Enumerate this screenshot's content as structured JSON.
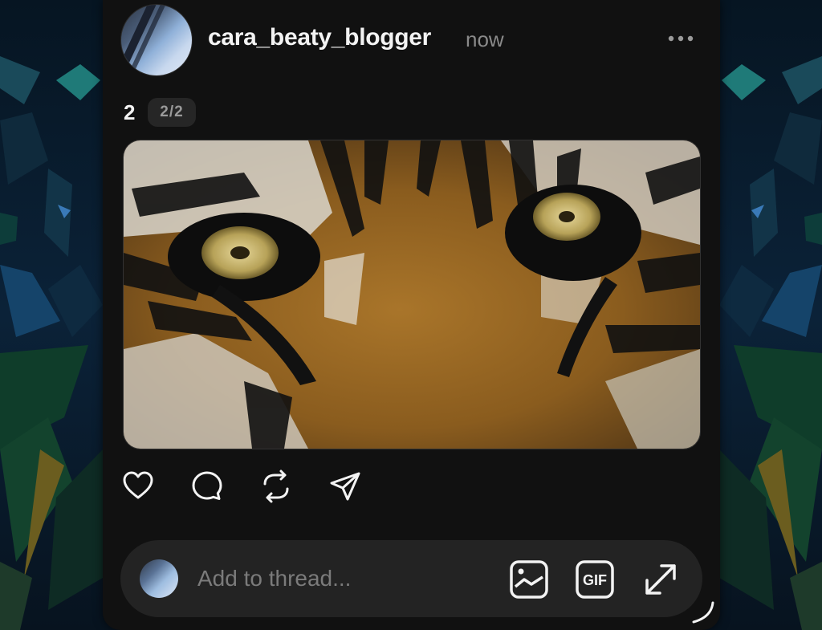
{
  "post": {
    "username": "cara_beaty_blogger",
    "timestamp": "now",
    "number": "2",
    "page_indicator": "2/2",
    "image_subject": "tiger-eyes-closeup"
  },
  "actions": [
    "heart-icon",
    "comment-icon",
    "repost-icon",
    "share-icon"
  ],
  "composer": {
    "placeholder": "Add to thread...",
    "gif_label": "GIF",
    "buttons": [
      "image-icon",
      "gif-icon",
      "expand-icon"
    ]
  },
  "colors": {
    "card": "#111111",
    "text_primary": "#f3f3f3",
    "text_muted": "#8a8a8a",
    "composer_bg": "#232323",
    "background": "#0a1a2a"
  }
}
